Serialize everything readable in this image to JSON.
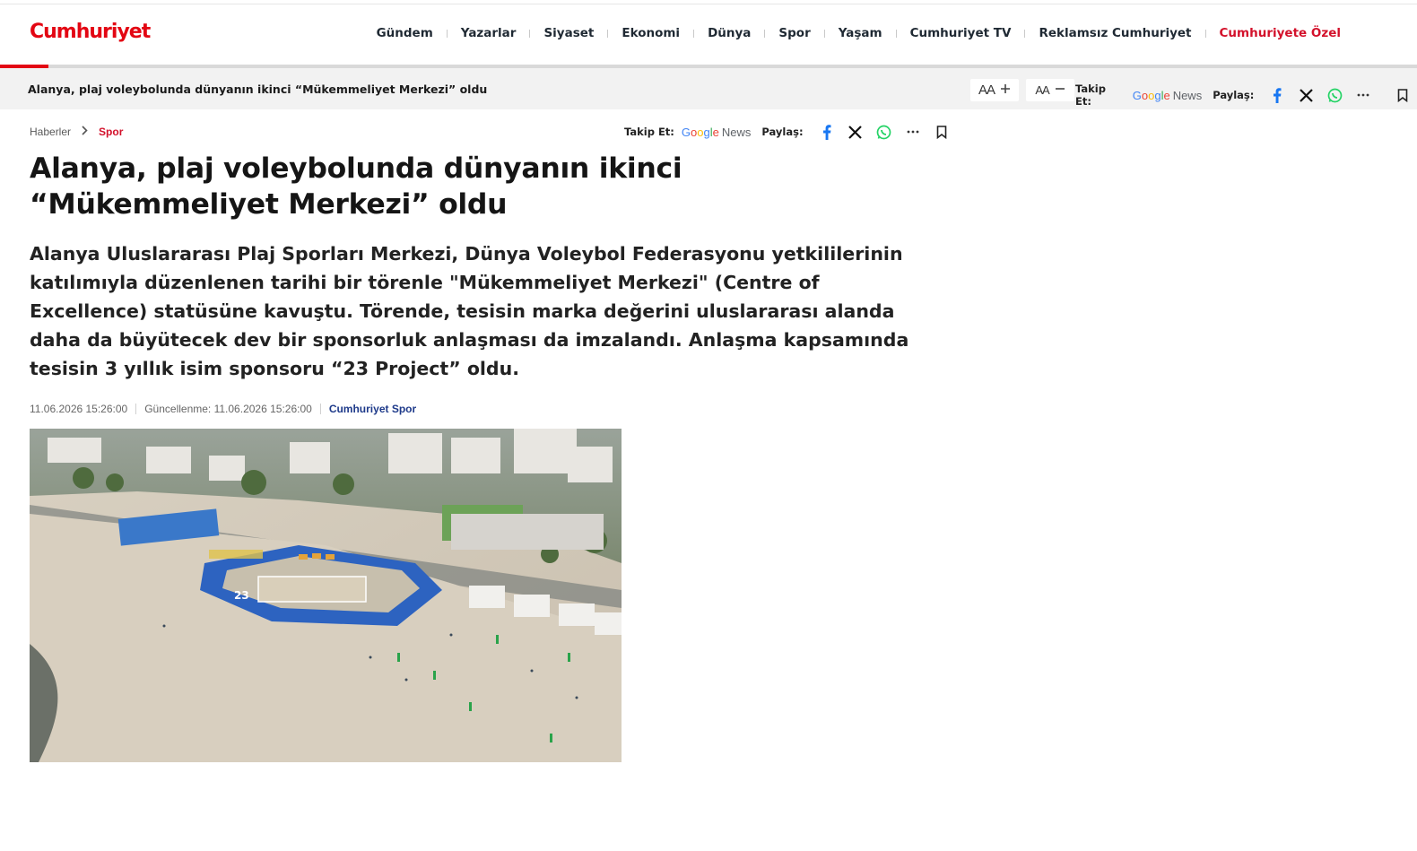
{
  "site": {
    "logo_text": "Cumhuriyet",
    "brand_color": "#e30613"
  },
  "nav": {
    "items": [
      "Gündem",
      "Yazarlar",
      "Siyaset",
      "Ekonomi",
      "Dünya",
      "Spor",
      "Yaşam",
      "Cumhuriyet TV",
      "Reklamsız Cumhuriyet"
    ],
    "special": "Cumhuriyete Özel"
  },
  "sticky": {
    "title": "Alanya, plaj voleybolunda dünyanın ikinci “Mükemmeliyet Merkezi” oldu",
    "font_increase_label": "AA",
    "font_decrease_label": "AA",
    "follow_label": "Takip Et:",
    "share_label": "Paylaş:"
  },
  "google_news": {
    "google": "Google",
    "news": "News"
  },
  "breadcrumb": {
    "home": "Haberler",
    "category": "Spor"
  },
  "article": {
    "follow_label": "Takip Et:",
    "share_label": "Paylaş:",
    "title": "Alanya, plaj voleybolunda dünyanın ikinci “Mükemmeliyet Merkezi” oldu",
    "summary": "Alanya Uluslararası Plaj Sporları Merkezi, Dünya Voleybol Federasyonu yetkililerinin katılımıyla düzenlenen tarihi bir törenle \"Mükemmeliyet Merkezi\" (Centre of Excellence) statüsüne kavuştu. Törende, tesisin marka değerini uluslararası alanda daha da büyütecek dev bir sponsorluk anlaşması da imzalandı. Anlaşma kapsamında tesisin 3 yıllık isim sponsoru “23 Project” oldu.",
    "published": "11.06.2026 15:26:00",
    "updated": "Güncellenme: 11.06.2026 15:26:00",
    "author": "Cumhuriyet Spor"
  },
  "icons": [
    "facebook-icon",
    "x-icon",
    "whatsapp-icon",
    "more-icon",
    "bookmark-icon",
    "chevron-right-icon",
    "plus-icon",
    "minus-icon"
  ]
}
